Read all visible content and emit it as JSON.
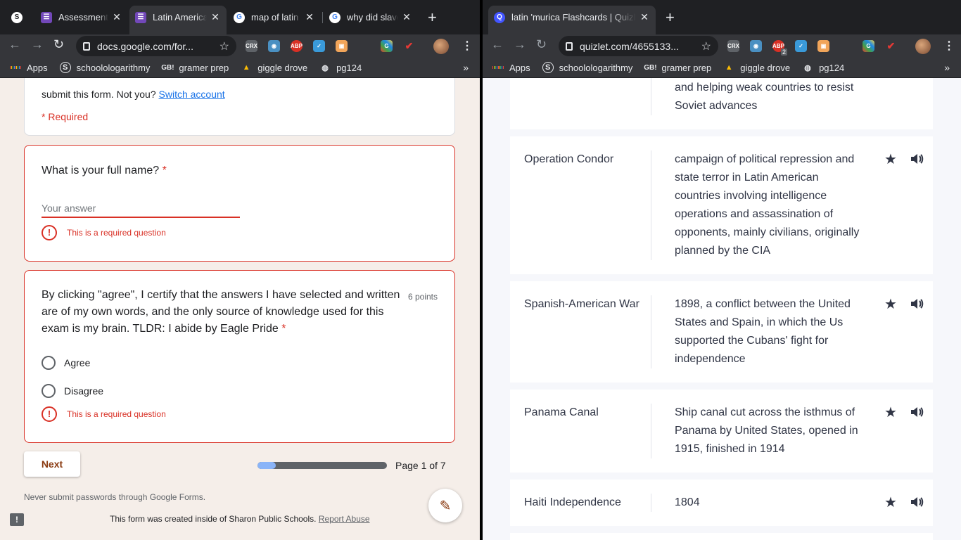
{
  "left_window": {
    "tabs": [
      {
        "title": "",
        "icon": "s-icon"
      },
      {
        "title": "Assessment",
        "icon": "forms-icon"
      },
      {
        "title": "Latin America",
        "icon": "forms-icon"
      },
      {
        "title": "map of latin a",
        "icon": "google-icon"
      },
      {
        "title": "why did slave",
        "icon": "google-icon"
      }
    ],
    "url": "docs.google.com/for...",
    "bookmarks": [
      "Apps",
      "schoolologarithmy",
      "gramer prep",
      "giggle drove",
      "pg124"
    ],
    "form": {
      "email_notice": "submit this form. Not you?",
      "switch_account": "Switch account",
      "required_note": "* Required",
      "q1_title": "What is your full name?",
      "q1_placeholder": "Your answer",
      "error_text": "This is a required question",
      "q2_title": "By clicking \"agree\", I certify that the answers I have selected and written are of my own words, and the only source of knowledge used for this exam is my brain. TLDR: I abide by Eagle Pride",
      "q2_points": "6 points",
      "options": [
        "Agree",
        "Disagree"
      ],
      "next_label": "Next",
      "page_label": "Page 1 of 7",
      "progress_fraction": 0.143,
      "never_submit": "Never submit passwords through Google Forms.",
      "created_by": "This form was created inside of Sharon Public Schools.",
      "report_abuse": "Report Abuse"
    }
  },
  "right_window": {
    "tab_title": "latin 'murica Flashcards | Quizlet",
    "url": "quizlet.com/4655133...",
    "bookmarks": [
      "Apps",
      "schoolologarithmy",
      "gramer prep",
      "giggle drove",
      "pg124"
    ],
    "abp_badge": "2",
    "cards": [
      {
        "term": "",
        "definition": "and helping weak countries to resist Soviet advances"
      },
      {
        "term": "Operation Condor",
        "definition": "campaign of political repression and state terror in Latin American countries involving intelligence operations and assassination of opponents, mainly civilians, originally planned by the CIA"
      },
      {
        "term": "Spanish-American War",
        "definition": "1898, a conflict between the United States and Spain, in which the Us supported the Cubans' fight for independence"
      },
      {
        "term": "Panama Canal",
        "definition": "Ship canal cut across the isthmus of Panama by United States, opened in 1915, finished in 1914"
      },
      {
        "term": "Haiti Independence",
        "definition": "1804"
      }
    ]
  },
  "colors": {
    "form_bg": "#f5eee9",
    "error_red": "#d93025",
    "accent_brown": "#8a3b12",
    "quizlet_bg": "#f6f7fb"
  }
}
